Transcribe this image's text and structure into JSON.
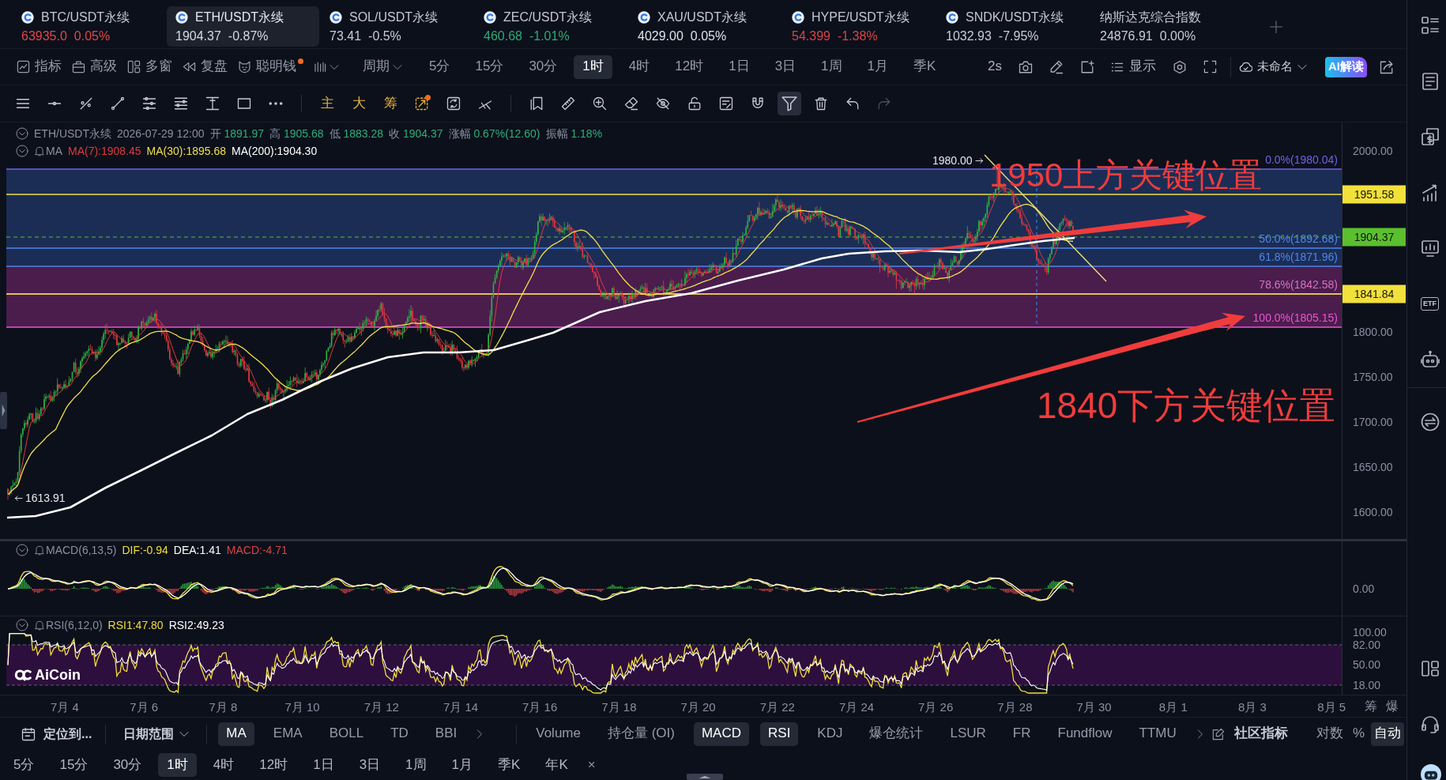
{
  "tickers": [
    {
      "kind": "coin",
      "name": "BTC/USDT永续",
      "price": "63935.0",
      "change": "0.05%",
      "color": "#e0474c",
      "selected": false
    },
    {
      "kind": "coin",
      "name": "ETH/USDT永续",
      "price": "1904.37",
      "change": "-0.87%",
      "color": "#d5d8e2",
      "selected": true
    },
    {
      "kind": "coin",
      "name": "SOL/USDT永续",
      "price": "73.41",
      "change": "-0.5%",
      "color": "#c9ccd6",
      "selected": false
    },
    {
      "kind": "coin",
      "name": "ZEC/USDT永续",
      "price": "460.68",
      "change": "-1.01%",
      "color": "#2eaa78",
      "selected": false
    },
    {
      "kind": "coin",
      "name": "XAU/USDT永续",
      "price": "4029.00",
      "change": "0.05%",
      "color": "#dfe2ea",
      "selected": false
    },
    {
      "kind": "coin",
      "name": "HYPE/USDT永续",
      "price": "54.399",
      "change": "-1.38%",
      "color": "#d9434a",
      "selected": false
    },
    {
      "kind": "coin",
      "name": "SNDK/USDT永续",
      "price": "1032.93",
      "change": "-7.95%",
      "color": "#c9ccd6",
      "selected": false
    },
    {
      "kind": "index",
      "name": "纳斯达克综合指数",
      "price": "24876.91",
      "change": "0.00%",
      "color": "#c9ccd6",
      "selected": false
    }
  ],
  "toolbar": {
    "tools": [
      {
        "label": "指标",
        "dot": false
      },
      {
        "label": "高级",
        "dot": false
      },
      {
        "label": "多窗",
        "dot": false
      },
      {
        "label": "复盘",
        "dot": false
      },
      {
        "label": "聪明钱",
        "dot": true
      }
    ],
    "period_menu": "周期",
    "periods": [
      {
        "label": "5分",
        "selected": false
      },
      {
        "label": "15分",
        "selected": false
      },
      {
        "label": "30分",
        "selected": false
      },
      {
        "label": "1时",
        "selected": true
      },
      {
        "label": "4时",
        "selected": false
      },
      {
        "label": "12时",
        "selected": false
      },
      {
        "label": "1日",
        "selected": false
      },
      {
        "label": "3日",
        "selected": false
      },
      {
        "label": "1周",
        "selected": false
      },
      {
        "label": "1月",
        "selected": false
      },
      {
        "label": "季K",
        "selected": false
      }
    ],
    "refresh_interval": "2s",
    "display": "显示",
    "layout_name": "未命名",
    "ai_button": "AI解读"
  },
  "drawing_toolbar": {
    "labels": [
      "主",
      "大",
      "筹"
    ],
    "middle_tools": [
      {
        "dot": true
      },
      {
        "dot": false
      },
      {
        "dot": false
      }
    ],
    "tools": [
      {
        "selected": false,
        "disabled": false
      },
      {
        "selected": false,
        "disabled": false
      },
      {
        "selected": false,
        "disabled": false
      },
      {
        "selected": false,
        "disabled": false
      },
      {
        "selected": false,
        "disabled": false
      },
      {
        "selected": false,
        "disabled": false
      },
      {
        "selected": false,
        "disabled": false
      },
      {
        "selected": false,
        "disabled": false
      },
      {
        "selected": true,
        "disabled": false
      },
      {
        "selected": false,
        "disabled": false
      },
      {
        "selected": false,
        "disabled": false
      },
      {
        "selected": false,
        "disabled": true
      }
    ]
  },
  "chart": {
    "header": {
      "symbol": "ETH/USDT永续",
      "time": "2026-07-29 12:00",
      "fields": [
        {
          "label": "开",
          "value": "1891.97"
        },
        {
          "label": "高",
          "value": "1905.68"
        },
        {
          "label": "低",
          "value": "1883.28"
        },
        {
          "label": "收",
          "value": "1904.37"
        },
        {
          "label": "涨幅",
          "value": "0.67%(12.60)"
        },
        {
          "label": "振幅",
          "value": "1.18%"
        }
      ]
    },
    "ma_legend": {
      "name": "MA",
      "items": [
        {
          "text": "MA(7):1908.45",
          "color": "#e0393f"
        },
        {
          "text": "MA(30):1895.68",
          "color": "#f3df4a"
        },
        {
          "text": "MA(200):1904.30",
          "color": "#ffffff"
        }
      ]
    },
    "fib_levels": [
      {
        "text": "0.0%(1980.04)",
        "color": "#6f63e8"
      },
      {
        "text": "50.0%(1892.68)",
        "color": "#4f86e8"
      },
      {
        "text": "61.8%(1871.96)",
        "color": "#4f86e8"
      },
      {
        "text": "78.6%(1842.58)",
        "color": "#d872c0"
      },
      {
        "text": "100.0%(1805.15)",
        "color": "#ec55d0"
      }
    ],
    "high_label": "1980.00",
    "low_label": "1613.91",
    "annotations": [
      "1950上方关键位置",
      "1840下方关键位置"
    ],
    "price_axis": [
      {
        "kind": "tick",
        "text": "2000.00"
      },
      {
        "kind": "badge",
        "text": "1951.58",
        "color": "#f2e03b",
        "dashed": false
      },
      {
        "kind": "badge",
        "text": "1904.37",
        "color": "#5ac02e",
        "dashed": true
      },
      {
        "kind": "badge",
        "text": "1841.84",
        "color": "#f2e03b",
        "dashed": false
      },
      {
        "kind": "tick",
        "text": "1800.00"
      },
      {
        "kind": "tick",
        "text": "1750.00"
      },
      {
        "kind": "tick",
        "text": "1700.00"
      },
      {
        "kind": "tick",
        "text": "1650.00"
      },
      {
        "kind": "tick",
        "text": "1600.00"
      }
    ]
  },
  "macd": {
    "name": "MACD(6,13,5)",
    "values": [
      {
        "text": "DIF:-0.94",
        "color": "#f2de3a"
      },
      {
        "text": "DEA:1.41",
        "color": "#ffffff"
      },
      {
        "text": "MACD:-4.71",
        "color": "#d9434a"
      }
    ],
    "axis": [
      "0.00"
    ]
  },
  "rsi": {
    "name": "RSI(6,12,0)",
    "values": [
      {
        "text": "RSI1:47.80",
        "color": "#f2de3a"
      },
      {
        "text": "RSI2:49.23",
        "color": "#ffffff"
      }
    ],
    "axis": [
      "100.00",
      "82.00",
      "50.00",
      "18.00"
    ]
  },
  "chart_logo": "AiCoin",
  "date_axis": {
    "labels": [
      "7月 4",
      "7月 6",
      "7月 8",
      "7月 10",
      "7月 12",
      "7月 14",
      "7月 16",
      "7月 18",
      "7月 20",
      "7月 22",
      "7月 24",
      "7月 26",
      "7月 28",
      "7月 30",
      "8月 1",
      "8月 3",
      "8月 5"
    ],
    "shortcuts": [
      "筹",
      "爆"
    ]
  },
  "indicator_bar": {
    "locate": "定位到...",
    "date_range": "日期范围",
    "main": [
      {
        "label": "MA",
        "selected": true
      },
      {
        "label": "EMA",
        "selected": false
      },
      {
        "label": "BOLL",
        "selected": false
      },
      {
        "label": "TD",
        "selected": false
      },
      {
        "label": "BBI",
        "selected": false
      }
    ],
    "sub": [
      {
        "label": "Volume",
        "selected": false
      },
      {
        "label": "持仓量 (OI)",
        "selected": false
      },
      {
        "label": "MACD",
        "selected": true
      },
      {
        "label": "RSI",
        "selected": true
      },
      {
        "label": "KDJ",
        "selected": false
      },
      {
        "label": "爆仓统计",
        "selected": false
      },
      {
        "label": "LSUR",
        "selected": false
      },
      {
        "label": "FR",
        "selected": false
      },
      {
        "label": "Fundflow",
        "selected": false
      },
      {
        "label": "TTMU",
        "selected": false
      }
    ],
    "community": "社区指标",
    "scale": [
      {
        "label": "对数",
        "selected": false
      },
      {
        "label": "%",
        "selected": false
      },
      {
        "label": "自动",
        "selected": true
      }
    ]
  },
  "period_bar": {
    "periods": [
      {
        "label": "5分",
        "selected": false
      },
      {
        "label": "15分",
        "selected": false
      },
      {
        "label": "30分",
        "selected": false
      },
      {
        "label": "1时",
        "selected": true
      },
      {
        "label": "4时",
        "selected": false
      },
      {
        "label": "12时",
        "selected": false
      },
      {
        "label": "1日",
        "selected": false
      },
      {
        "label": "3日",
        "selected": false
      },
      {
        "label": "1周",
        "selected": false
      },
      {
        "label": "1月",
        "selected": false
      },
      {
        "label": "季K",
        "selected": false
      },
      {
        "label": "年K",
        "selected": false
      }
    ],
    "close": "×"
  },
  "sidebar": {
    "etf_label": "ETF"
  }
}
